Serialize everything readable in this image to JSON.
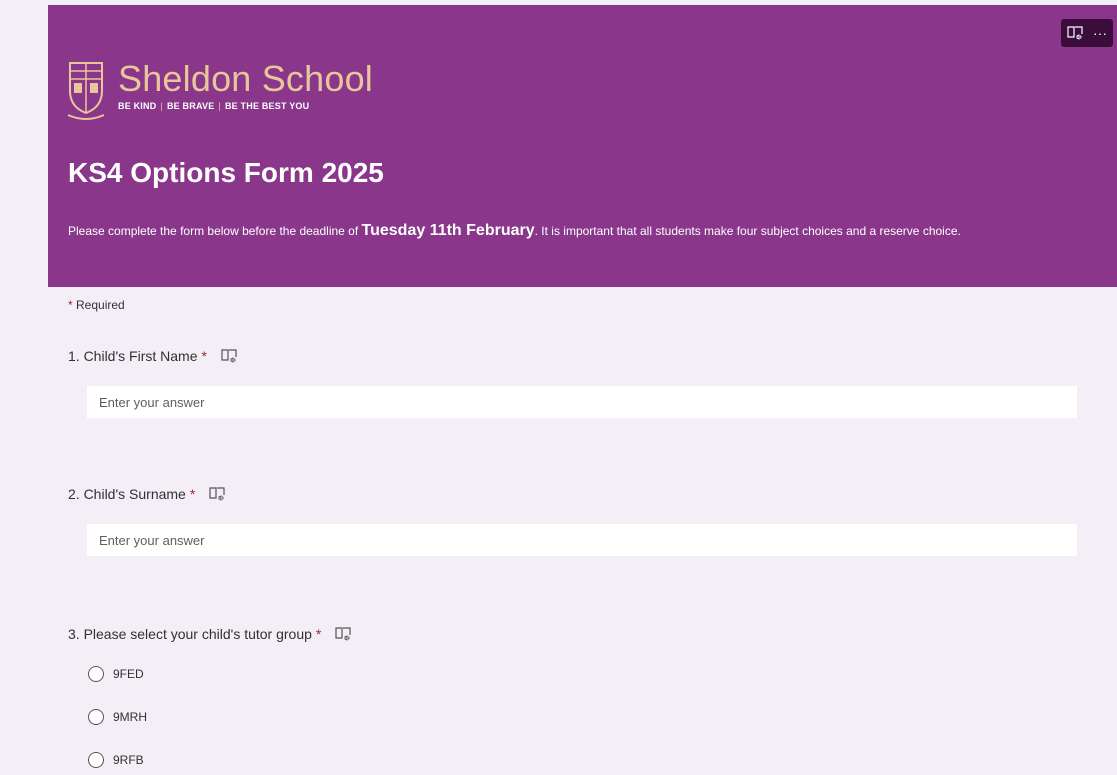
{
  "header": {
    "school_name": "Sheldon School",
    "tagline": {
      "part1": "BE KIND",
      "sep1": "|",
      "part2": "BE BRAVE",
      "sep2": "|",
      "part3": "BE THE BEST YOU"
    },
    "form_title": "KS4 Options Form 2025",
    "description": {
      "before": "Please complete the form below before the deadline of ",
      "deadline": "Tuesday 11th February",
      "after": ". It is important that all students make four subject choices and a reserve choice."
    },
    "colors": {
      "banner": "#8a378b",
      "logo_text": "#e8c59a"
    }
  },
  "toolbar": {
    "reader_icon": "immersive-reader-icon",
    "more_label": "···"
  },
  "required_note": {
    "star": "*",
    "text": "Required"
  },
  "questions": [
    {
      "label": "1. Child's First Name",
      "star": "*",
      "placeholder": "Enter your answer"
    },
    {
      "label": "2. Child's Surname",
      "star": "*",
      "placeholder": "Enter your answer"
    },
    {
      "label": "3. Please select your child's tutor group",
      "star": "*",
      "options": [
        "9FED",
        "9MRH",
        "9RFB"
      ]
    }
  ]
}
